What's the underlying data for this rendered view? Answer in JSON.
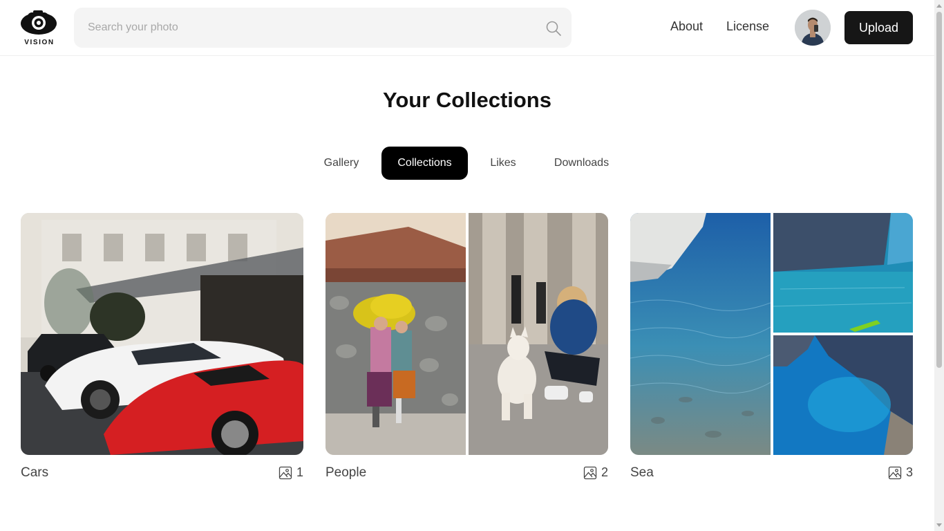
{
  "brand": {
    "name": "VISION"
  },
  "search": {
    "placeholder": "Search your photo"
  },
  "nav": {
    "about": "About",
    "license": "License",
    "upload": "Upload"
  },
  "page": {
    "title": "Your Collections"
  },
  "tabs": [
    {
      "label": "Gallery",
      "active": false
    },
    {
      "label": "Collections",
      "active": true
    },
    {
      "label": "Likes",
      "active": false
    },
    {
      "label": "Downloads",
      "active": false
    }
  ],
  "collections": [
    {
      "name": "Cars",
      "count": "1",
      "photos": [
        "city street with parked white and red sports cars"
      ]
    },
    {
      "name": "People",
      "count": "2",
      "photos": [
        "two children holding yellow flowers",
        "child kneeling with white dog"
      ]
    },
    {
      "name": "Sea",
      "count": "3",
      "photos": [
        "boat over clear blue water",
        "rocky cliff with kayak",
        "blue cove with cliffs"
      ]
    }
  ],
  "icons": {
    "search": "search-icon",
    "image": "image-icon",
    "logo": "camera-logo-icon"
  },
  "colors": {
    "primary": "#161616",
    "tab_active_bg": "#000000",
    "search_bg": "#f4f4f4"
  }
}
